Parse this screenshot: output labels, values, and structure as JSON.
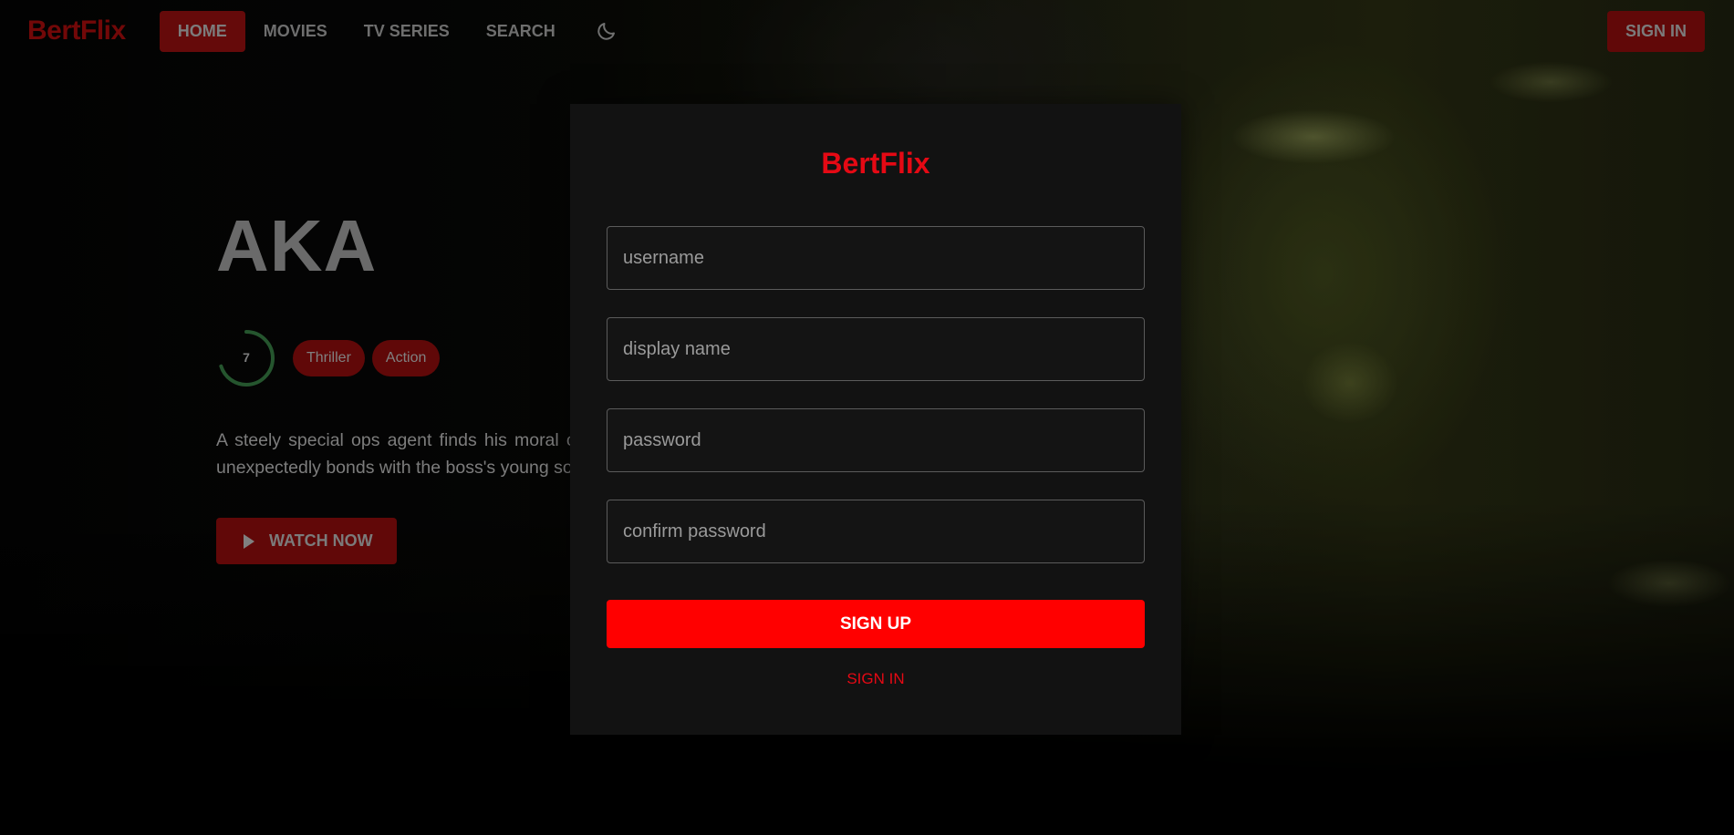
{
  "brand": {
    "name": "BertFlix",
    "accent_color": "#e50914"
  },
  "nav": {
    "items": [
      {
        "label": "HOME",
        "active": true
      },
      {
        "label": "MOVIES",
        "active": false
      },
      {
        "label": "TV SERIES",
        "active": false
      },
      {
        "label": "SEARCH",
        "active": false
      }
    ],
    "theme_icon": "moon-icon",
    "sign_in_label": "SIGN IN"
  },
  "hero": {
    "title": "AKA",
    "rating": "7",
    "rating_fraction": 0.7,
    "genres": [
      "Thriller",
      "Action"
    ],
    "description": "A steely special ops agent finds his moral compass tested when he infiltrates a crime syndicate and unexpectedly bonds with the boss's young son.",
    "watch_label": "WATCH NOW",
    "watch_icon": "play-icon"
  },
  "signup_form": {
    "logo": "BertFlix",
    "username_placeholder": "username",
    "display_name_placeholder": "display name",
    "password_placeholder": "password",
    "confirm_password_placeholder": "confirm password",
    "submit_label": "SIGN UP",
    "switch_label": "SIGN IN"
  }
}
